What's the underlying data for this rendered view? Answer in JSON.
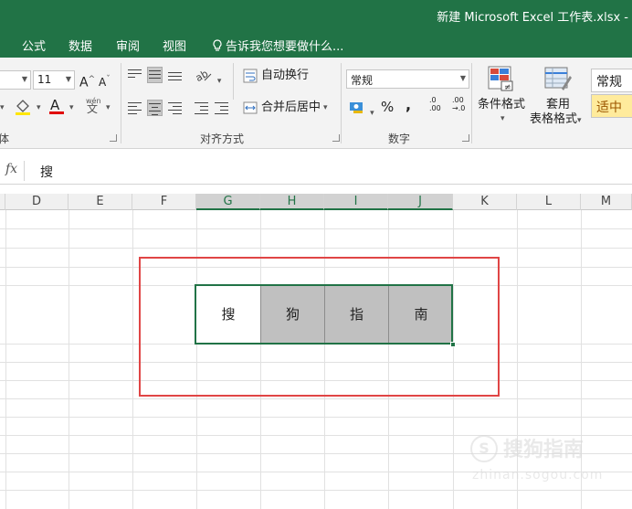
{
  "window": {
    "title": "新建 Microsoft Excel 工作表.xlsx -"
  },
  "menu": {
    "tabs": [
      "公式",
      "数据",
      "审阅",
      "视图"
    ],
    "tell_me": "告诉我您想要做什么..."
  },
  "ribbon": {
    "font": {
      "size": "11",
      "group_label": "体",
      "phonetic": "wén"
    },
    "alignment": {
      "wrap_text": "自动换行",
      "merge_center": "合并后居中",
      "group_label": "对齐方式"
    },
    "number": {
      "format": "常规",
      "percent": "%",
      "comma": ",",
      "inc_decimal_a": ".0",
      "inc_decimal_b": ".00",
      "dec_decimal_a": ".00",
      "dec_decimal_b": "→.0",
      "group_label": "数字"
    },
    "styles": {
      "conditional": "条件格式",
      "table_line1": "套用",
      "table_line2": "表格格式",
      "style_normal": "常规",
      "style_neutral": "适中"
    }
  },
  "formula_bar": {
    "fx": "fx",
    "value": "搜"
  },
  "columns": [
    "D",
    "E",
    "F",
    "G",
    "H",
    "I",
    "J",
    "K",
    "L",
    "M"
  ],
  "cells": [
    {
      "col": "G",
      "text": "搜",
      "fill": "#ffffff"
    },
    {
      "col": "H",
      "text": "狗",
      "fill": "#c0c0c0"
    },
    {
      "col": "I",
      "text": "指",
      "fill": "#c0c0c0"
    },
    {
      "col": "J",
      "text": "南",
      "fill": "#c0c0c0"
    }
  ],
  "colors": {
    "accent": "#217346",
    "highlight_frame": "#e04545",
    "neutral_style": "#ffeb9c"
  },
  "watermark": {
    "brand": "搜狗指南",
    "logo_letter": "S",
    "url": "zhinan.sogou.com"
  }
}
